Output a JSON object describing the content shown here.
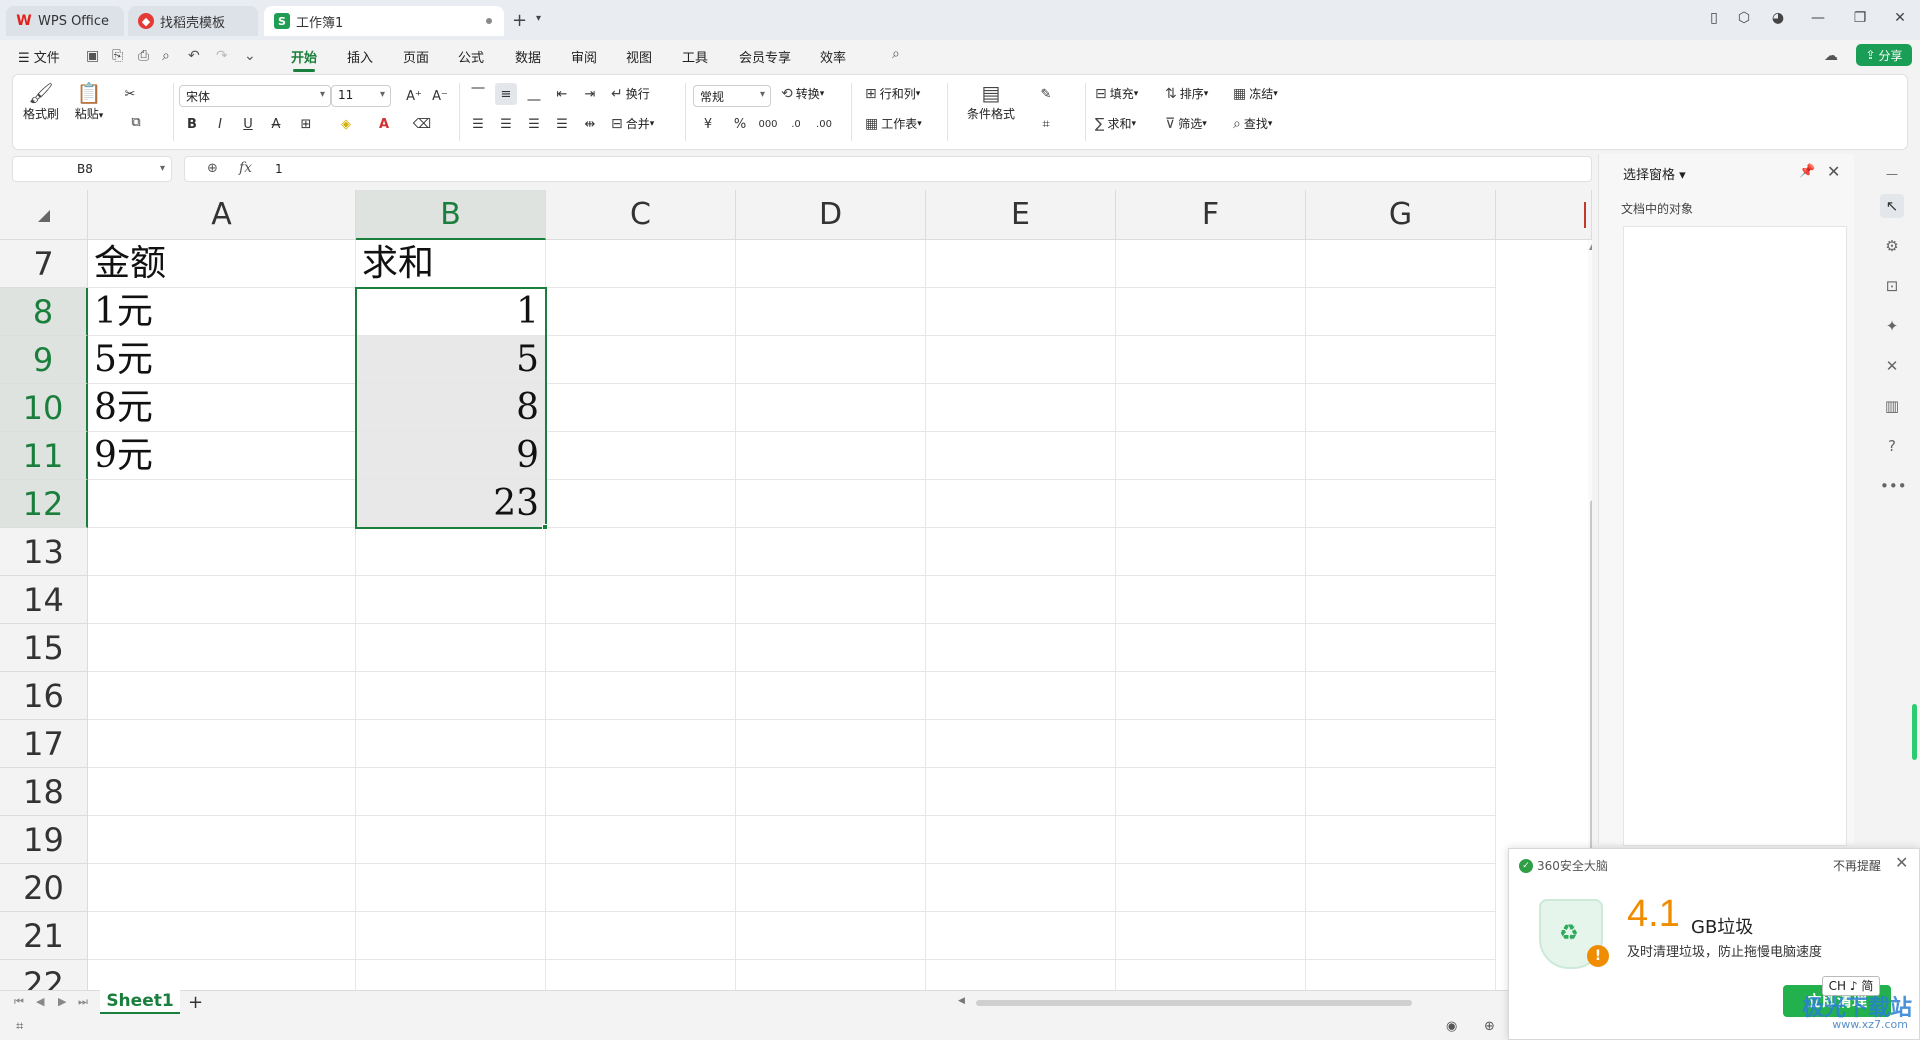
{
  "titlebar": {
    "tabs": [
      {
        "label": "WPS Office",
        "icon": "wps-logo-icon"
      },
      {
        "label": "找稻壳模板",
        "icon": "docer-icon"
      },
      {
        "label": "工作簿1",
        "icon": "spreadsheet-icon",
        "active": true
      }
    ]
  },
  "menu": {
    "file": "☰ 文件",
    "tabs": [
      "开始",
      "插入",
      "页面",
      "公式",
      "数据",
      "审阅",
      "视图",
      "工具",
      "会员专享",
      "效率"
    ],
    "active_tab": "开始",
    "share": "分享"
  },
  "ribbon": {
    "format_painter": "格式刷",
    "paste": "粘贴",
    "font_name": "宋体",
    "font_size": "11",
    "wrap": "换行",
    "merge": "合并",
    "number_format": "常规",
    "convert": "转换",
    "row_col": "行和列",
    "worksheet": "工作表",
    "conditional_format": "条件格式",
    "fill": "填充",
    "sort": "排序",
    "freeze": "冻结",
    "sum": "求和",
    "filter": "筛选",
    "find": "查找"
  },
  "formula_bar": {
    "cell_ref": "B8",
    "fx": "fx",
    "value": "1"
  },
  "sheet": {
    "columns": [
      "A",
      "B",
      "C",
      "D",
      "E",
      "F",
      "G"
    ],
    "selected_column": "B",
    "rows": [
      {
        "num": "7",
        "a": "金额",
        "b": "求和"
      },
      {
        "num": "8",
        "a": "1元",
        "b": "1"
      },
      {
        "num": "9",
        "a": "5元",
        "b": "5"
      },
      {
        "num": "10",
        "a": "8元",
        "b": "8"
      },
      {
        "num": "11",
        "a": "9元",
        "b": "9"
      },
      {
        "num": "12",
        "a": "",
        "b": "23"
      },
      {
        "num": "13",
        "a": "",
        "b": ""
      },
      {
        "num": "14",
        "a": "",
        "b": ""
      },
      {
        "num": "15",
        "a": "",
        "b": ""
      },
      {
        "num": "16",
        "a": "",
        "b": ""
      },
      {
        "num": "17",
        "a": "",
        "b": ""
      },
      {
        "num": "18",
        "a": "",
        "b": ""
      },
      {
        "num": "19",
        "a": "",
        "b": ""
      },
      {
        "num": "20",
        "a": "",
        "b": ""
      },
      {
        "num": "21",
        "a": "",
        "b": ""
      },
      {
        "num": "22",
        "a": "",
        "b": ""
      }
    ],
    "selected_rows": [
      "8",
      "9",
      "10",
      "11",
      "12"
    ],
    "sheet_tab": "Sheet1"
  },
  "side_panel": {
    "title": "选择窗格 ▾",
    "subtitle": "文档中的对象"
  },
  "popup": {
    "brand": "360安全大脑",
    "dismiss": "不再提醒",
    "size": "4.1",
    "unit": "GB垃圾",
    "tip": "及时清理垃圾，防止拖慢电脑速度",
    "button": "立即清理"
  },
  "ime": "CH ♪ 简",
  "watermark": {
    "line1": "极光下载站",
    "line2": "www.xz7.com"
  },
  "colors": {
    "accent": "#1a7f3c",
    "share": "#1a9e55",
    "popup_accent": "#f08c00"
  }
}
